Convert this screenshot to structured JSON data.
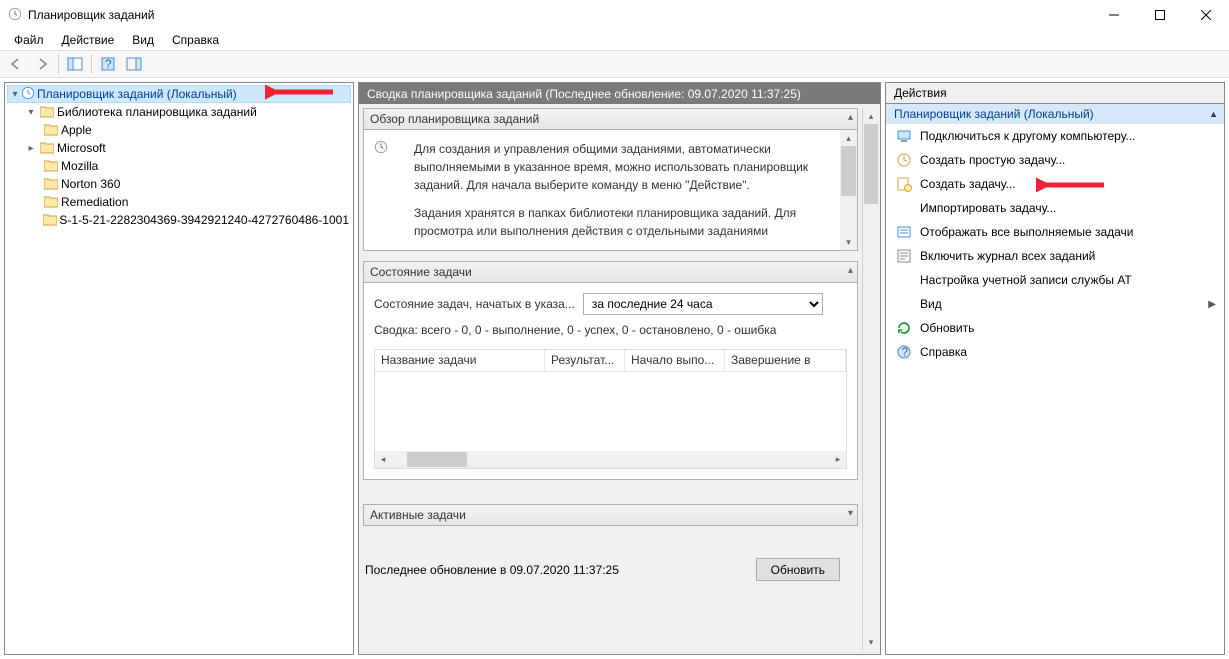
{
  "window": {
    "title": "Планировщик заданий"
  },
  "menu": {
    "file": "Файл",
    "action": "Действие",
    "view": "Вид",
    "help": "Справка"
  },
  "tree": {
    "root": "Планировщик заданий (Локальный)",
    "library": "Библиотека планировщика заданий",
    "items": [
      "Apple",
      "Microsoft",
      "Mozilla",
      "Norton 360",
      "Remediation",
      "S-1-5-21-2282304369-3942921240-4272760486-1001"
    ]
  },
  "center": {
    "header": "Сводка планировщика заданий (Последнее обновление: 09.07.2020 11:37:25)",
    "overview_title": "Обзор планировщика заданий",
    "overview_p1": "Для создания и управления общими заданиями, автоматически выполняемыми в указанное время, можно использовать планировщик заданий. Для начала выберите команду в меню \"Действие\".",
    "overview_p2": "Задания хранятся в папках библиотеки планировщика заданий. Для просмотра или выполнения действия с отдельными заданиями",
    "status_title": "Состояние задачи",
    "status_label": "Состояние задач, начатых в указа...",
    "status_select": "за последние 24 часа",
    "summary": "Сводка: всего - 0, 0 - выполнение, 0 - успех, 0 - остановлено, 0 - ошибка",
    "columns": {
      "name": "Название задачи",
      "result": "Результат...",
      "start": "Начало выпо...",
      "end": "Завершение в"
    },
    "active_title": "Активные задачи",
    "footer_label": "Последнее обновление в 09.07.2020 11:37:25",
    "refresh_btn": "Обновить"
  },
  "actions": {
    "header": "Действия",
    "group_title": "Планировщик заданий (Локальный)",
    "items": {
      "connect": "Подключиться к другому компьютеру...",
      "create_basic": "Создать простую задачу...",
      "create_task": "Создать задачу...",
      "import": "Импортировать задачу...",
      "show_running": "Отображать все выполняемые задачи",
      "enable_history": "Включить журнал всех заданий",
      "at_account": "Настройка учетной записи службы AT",
      "view": "Вид",
      "refresh": "Обновить",
      "help": "Справка"
    }
  }
}
